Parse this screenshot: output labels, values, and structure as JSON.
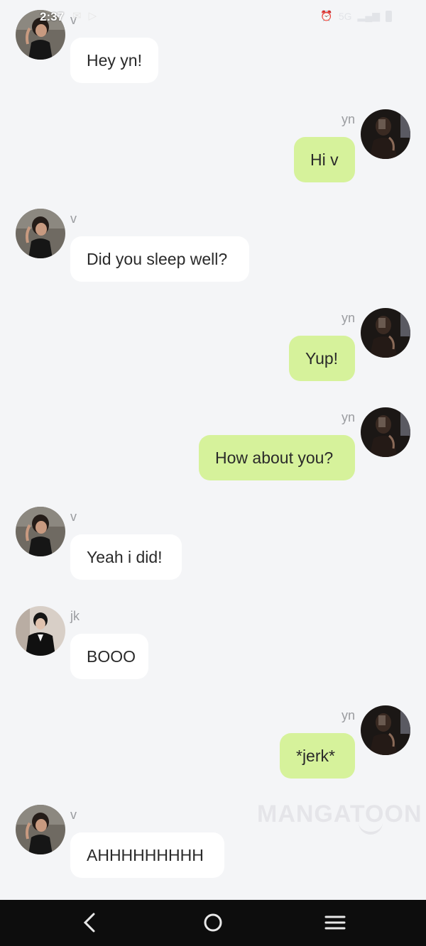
{
  "status_bar": {
    "time": "2:37",
    "network": "5G"
  },
  "messages": [
    {
      "sender": "v",
      "direction": "in",
      "text": "Hey yn!",
      "avatar": "v-avatar"
    },
    {
      "sender": "yn",
      "direction": "out",
      "text": "Hi v",
      "avatar": "yn-avatar"
    },
    {
      "sender": "v",
      "direction": "in",
      "text": "Did you sleep well?",
      "avatar": "v-avatar"
    },
    {
      "sender": "yn",
      "direction": "out",
      "text": "Yup!",
      "avatar": "yn-avatar"
    },
    {
      "sender": "yn",
      "direction": "out",
      "text": "How about you?",
      "avatar": "yn-avatar"
    },
    {
      "sender": "v",
      "direction": "in",
      "text": "Yeah i did!",
      "avatar": "v-avatar"
    },
    {
      "sender": "jk",
      "direction": "in",
      "text": "BOOO",
      "avatar": "jk-avatar"
    },
    {
      "sender": "yn",
      "direction": "out",
      "text": "*jerk*",
      "avatar": "yn-avatar"
    },
    {
      "sender": "v",
      "direction": "in",
      "text": "AHHHHHHHHH",
      "avatar": "v-avatar"
    }
  ],
  "watermark": "MANGATOON",
  "nav_bar": {
    "back": "back-icon",
    "home": "home-icon",
    "recent": "menu-icon"
  },
  "colors": {
    "background": "#f4f5f7",
    "incoming_bubble": "#ffffff",
    "outgoing_bubble": "#d6f29b",
    "sender_label": "#9a9ca0",
    "nav_bar": "#0d0d0d"
  }
}
